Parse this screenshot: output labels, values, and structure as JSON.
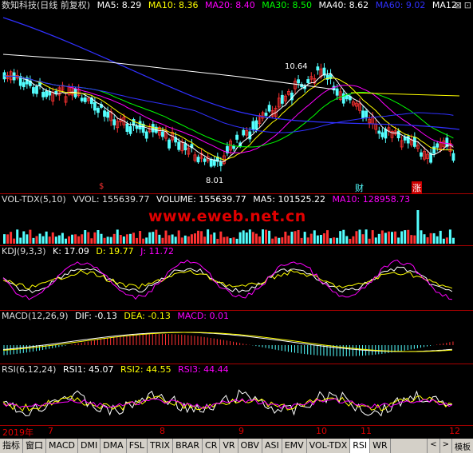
{
  "main": {
    "title": "数知科技(日线 前复权)",
    "ma": [
      {
        "label": "MA5: 8.29",
        "color": "#ffffff"
      },
      {
        "label": "MA10: 8.36",
        "color": "#ffff00"
      },
      {
        "label": "MA20: 8.40",
        "color": "#ff00ff"
      },
      {
        "label": "MA30: 8.50",
        "color": "#00ff00"
      },
      {
        "label": "MA40: 8.62",
        "color": "#ffffff"
      },
      {
        "label": "MA60: 9.02",
        "color": "#0000ff"
      },
      {
        "label": "MA12",
        "color": "#ffffff"
      }
    ],
    "high_label": "10.64",
    "low_label": "8.01",
    "marker_dollar": "$",
    "marker_cai": "财",
    "marker_zhang": "涨"
  },
  "vol": {
    "name": "VOL-TDX(5,10)",
    "vvol": "VVOL: 155639.77",
    "volume": "VOLUME: 155639.77",
    "ma5": "MA5: 101525.22",
    "ma10": "MA10: 128958.73"
  },
  "watermark": "www.eweb.net.cn",
  "kdj": {
    "name": "KDJ(9,3,3)",
    "k": "K: 17.09",
    "d": "D: 19.77",
    "j": "J: 11.72"
  },
  "macd": {
    "name": "MACD(12,26,9)",
    "dif": "DIF: -0.13",
    "dea": "DEA: -0.13",
    "macd": "MACD: 0.01"
  },
  "rsi": {
    "name": "RSI(6,12,24)",
    "rsi1": "RSI1: 45.07",
    "rsi2": "RSI2: 44.55",
    "rsi3": "RSI3: 44.44"
  },
  "timeaxis": {
    "year": "2019年",
    "months": [
      "7",
      "8",
      "9",
      "10",
      "11",
      "12"
    ]
  },
  "tabs": [
    "指标",
    "窗口",
    "MACD",
    "DMI",
    "DMA",
    "FSL",
    "TRIX",
    "BRAR",
    "CR",
    "VR",
    "OBV",
    "ASI",
    "EMV",
    "VOL-TDX",
    "RSI",
    "WR"
  ],
  "active_tab": "RSI",
  "nav": {
    "left": "<",
    "right": ">",
    "template": "模板"
  },
  "colors": {
    "up": "#ff3232",
    "down": "#54ffff",
    "separator": "#aa0000",
    "axis_text": "#e00000"
  }
}
